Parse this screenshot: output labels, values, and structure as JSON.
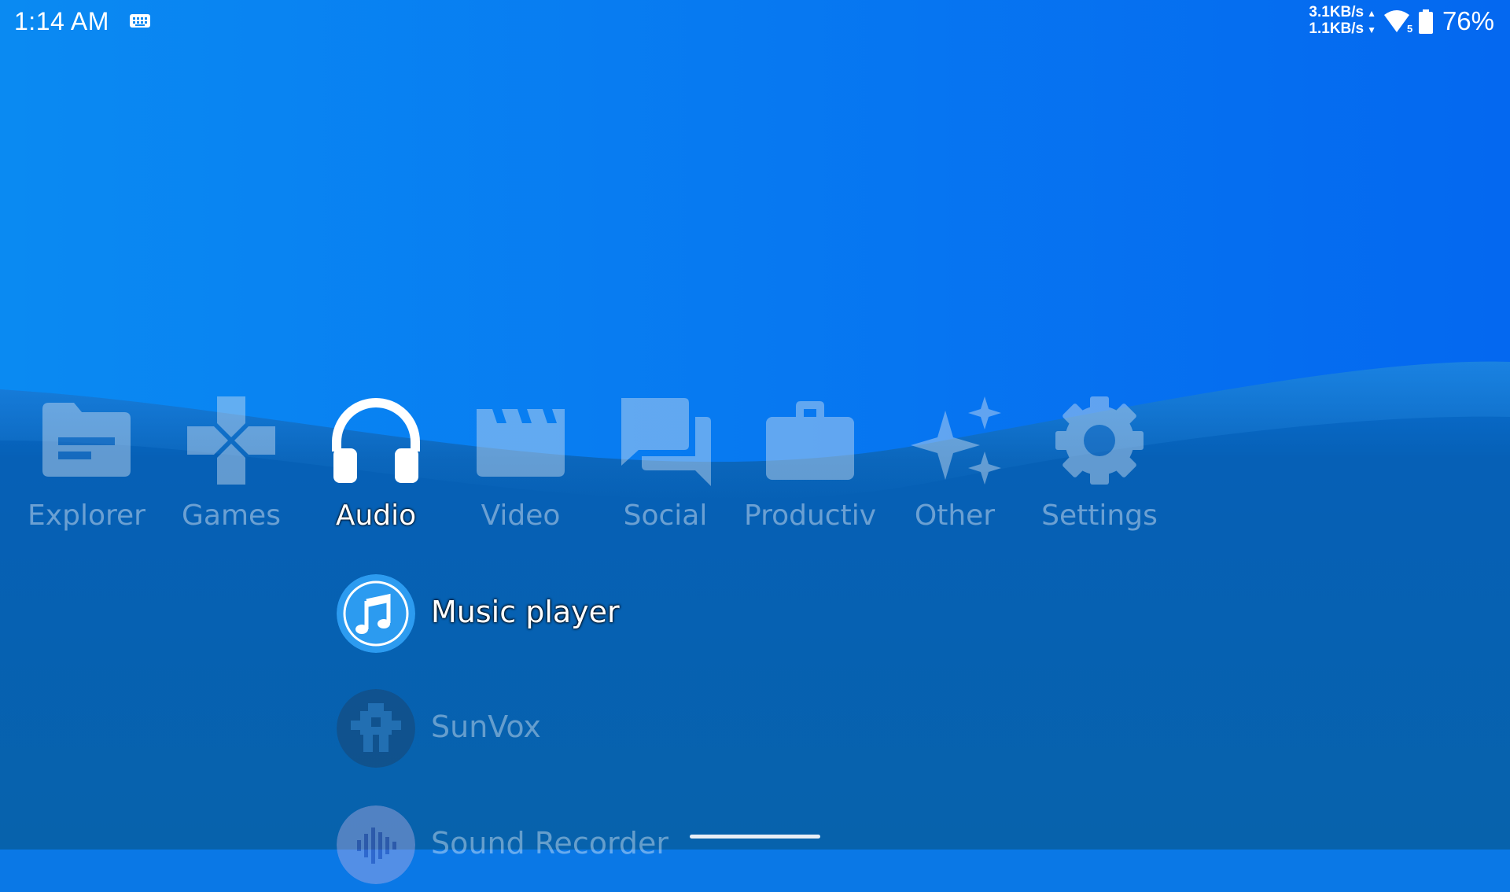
{
  "status_bar": {
    "time": "1:14 AM",
    "upload_speed": "3.1KB/s",
    "download_speed": "1.1KB/s",
    "wifi_badge": "5",
    "battery": "76%",
    "icons": [
      "keyboard-icon",
      "wifi-icon",
      "battery-icon"
    ]
  },
  "categories": [
    {
      "label": "Explorer",
      "icon": "folder-icon",
      "active": false
    },
    {
      "label": "Games",
      "icon": "gamepad-icon",
      "active": false
    },
    {
      "label": "Audio",
      "icon": "headphones-icon",
      "active": true
    },
    {
      "label": "Video",
      "icon": "clapperboard-icon",
      "active": false
    },
    {
      "label": "Social",
      "icon": "chat-icon",
      "active": false
    },
    {
      "label": "Productiv",
      "icon": "briefcase-icon",
      "active": false
    },
    {
      "label": "Other",
      "icon": "sparkles-icon",
      "active": false
    },
    {
      "label": "Settings",
      "icon": "gear-icon",
      "active": false
    }
  ],
  "apps": [
    {
      "label": "Music player",
      "icon": "music-note-icon",
      "selected": true
    },
    {
      "label": "SunVox",
      "icon": "sunvox-icon",
      "selected": false
    },
    {
      "label": "Sound Recorder",
      "icon": "sound-recorder-icon",
      "selected": false
    }
  ],
  "colors": {
    "background_top": "#0a86f0",
    "background_bottom": "#0258a8",
    "wave": "#0a6fd4",
    "music_icon": "#2c9bf0"
  }
}
